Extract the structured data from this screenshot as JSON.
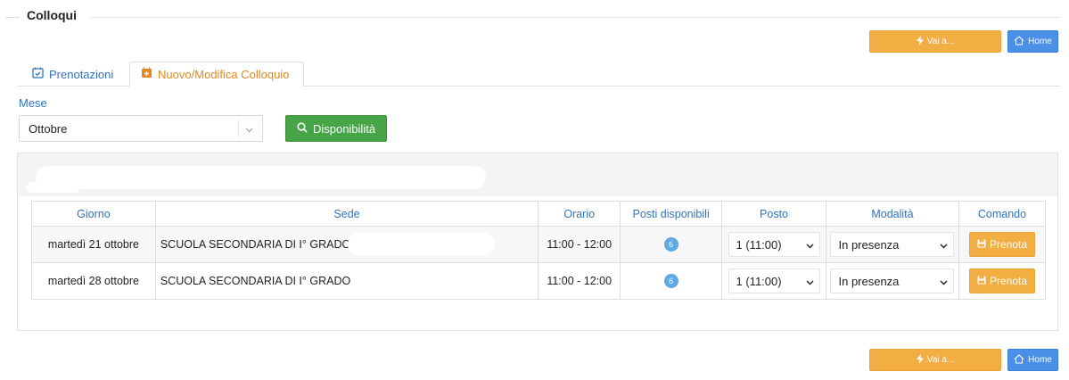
{
  "section": {
    "title": "Colloqui"
  },
  "actions": {
    "vai_label": "Vai a...",
    "home_label": "Home"
  },
  "tabs": [
    {
      "label": "Prenotazioni",
      "icon": "calendar-check-icon",
      "active": false
    },
    {
      "label": "Nuovo/Modifica Colloquio",
      "icon": "calendar-plus-icon",
      "active": true
    }
  ],
  "filter": {
    "mese_label": "Mese",
    "mese_value": "Ottobre",
    "search_label": "Disponibilità"
  },
  "table": {
    "headers": [
      "Giorno",
      "Sede",
      "Orario",
      "Posti disponibili",
      "Posto",
      "Modalità",
      "Comando"
    ],
    "rows": [
      {
        "giorno": "martedì 21 ottobre",
        "sede": "SCUOLA SECONDARIA DI I° GRADO",
        "orario": "11:00 - 12:00",
        "posti": "6",
        "posto": "1 (11:00)",
        "modalita": "In presenza",
        "comando": "Prenota"
      },
      {
        "giorno": "martedì 28 ottobre",
        "sede": "SCUOLA SECONDARIA DI I° GRADO",
        "orario": "11:00 - 12:00",
        "posti": "6",
        "posto": "1 (11:00)",
        "modalita": "In presenza",
        "comando": "Prenota"
      }
    ]
  },
  "colors": {
    "accent_blue": "#2f74c0",
    "orange": "#f2ae43",
    "green": "#47a447",
    "home_blue": "#4a8fe8",
    "tab_active": "#e8871e"
  }
}
